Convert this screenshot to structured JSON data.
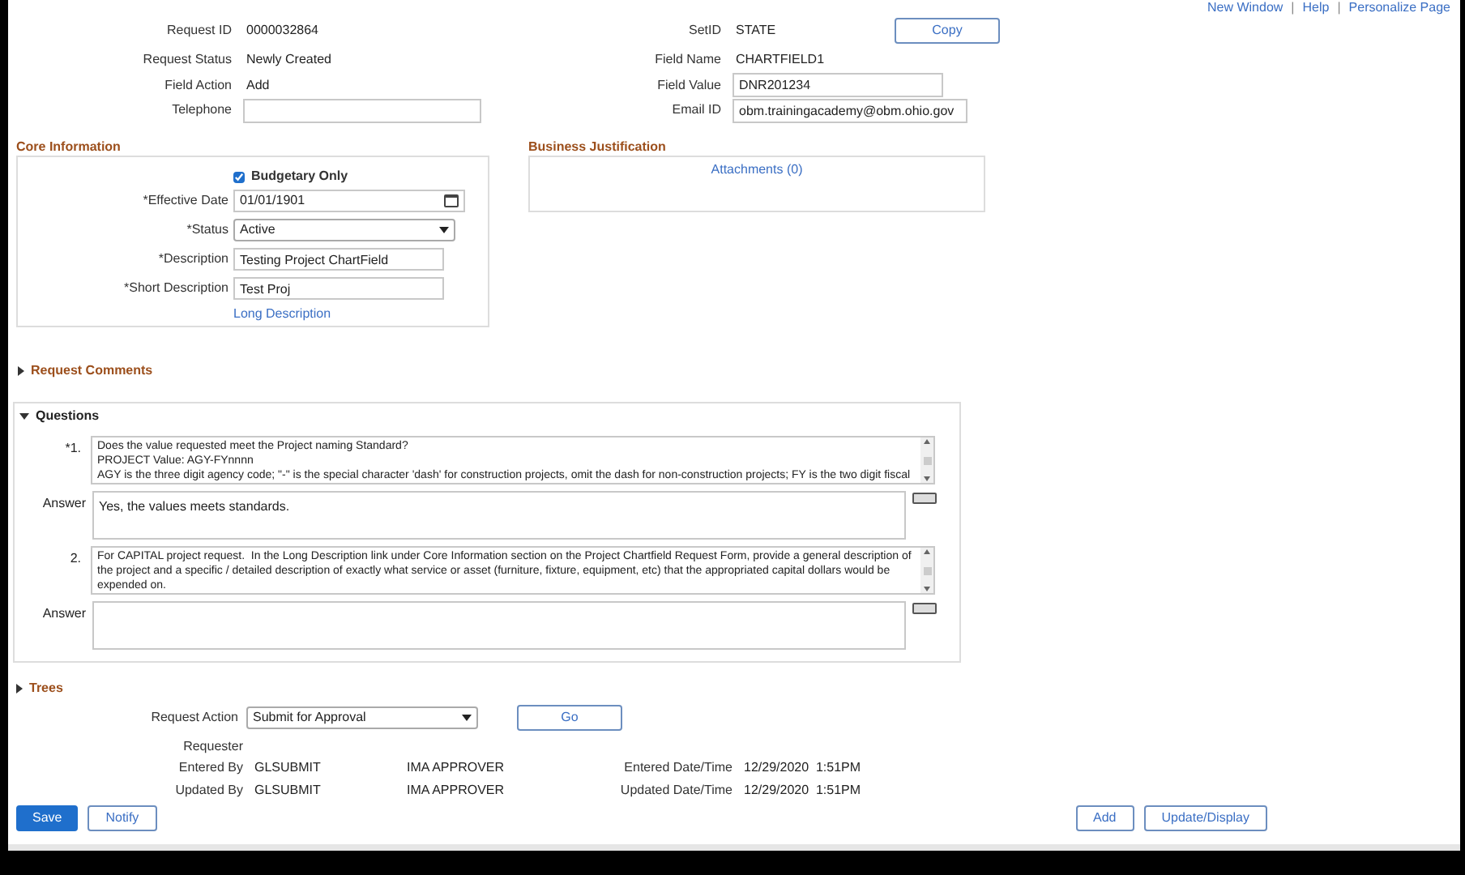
{
  "header_links": [
    "New Window",
    "Help",
    "Personalize Page"
  ],
  "header_link_separator": "|",
  "header_left": [
    {
      "label": "Request ID",
      "value": "0000032864",
      "kind": "text"
    },
    {
      "label": "Request Status",
      "value": "Newly Created",
      "kind": "text"
    },
    {
      "label": "Field Action",
      "value": "Add",
      "kind": "text"
    },
    {
      "label": "Telephone",
      "kind": "input"
    }
  ],
  "header_right": [
    {
      "label": "SetID",
      "value": "STATE",
      "kind": "text"
    },
    {
      "label": "Field Name",
      "value": "CHARTFIELD1",
      "kind": "text"
    },
    {
      "label": "Field Value",
      "value": "DNR201234",
      "kind": "input"
    },
    {
      "label": "Email ID",
      "value": "obm.trainingacademy@obm.ohio.gov",
      "kind": "input"
    }
  ],
  "copy_button": "Copy",
  "core_information": {
    "title": "Core Information",
    "budgetary_only": {
      "label": "Budgetary Only",
      "checked": true
    },
    "fields": [
      {
        "label": "*Effective Date",
        "value": "01/01/1901",
        "kind": "date"
      },
      {
        "label": "*Status",
        "value": "Active",
        "kind": "select"
      },
      {
        "label": "*Description",
        "value": "Testing Project ChartField",
        "kind": "input"
      },
      {
        "label": "*Short Description",
        "value": "Test Proj",
        "kind": "input"
      }
    ],
    "link": "Long Description"
  },
  "business_justification": {
    "title": "Business Justification",
    "link": "Attachments (0)"
  },
  "request_comments": {
    "title": "Request Comments",
    "expanded": false
  },
  "questions": {
    "title": "Questions",
    "expanded": true,
    "items": [
      {
        "number": "*1.",
        "text": "Does the value requested meet the Project naming Standard?\nPROJECT Value: AGY-FYnnnn\nAGY is the three digit agency code; \"-\" is the special character 'dash' for construction projects, omit the dash for non-construction projects; FY is the two digit fiscal",
        "answer_label": "Answer",
        "answer": "Yes, the values meets standards."
      },
      {
        "number": "2.",
        "text": "For CAPITAL project request.  In the Long Description link under Core Information section on the Project Chartfield Request Form, provide a general description of the project and a specific / detailed description of exactly what service or asset (furniture, fixture, equipment, etc) that the appropriated capital dollars would be expended on.",
        "answer_label": "Answer"
      }
    ]
  },
  "trees": {
    "title": "Trees",
    "expanded": false
  },
  "request_action": {
    "label": "Request Action",
    "value": "Submit for Approval",
    "button": "Go"
  },
  "requester_label": "Requester",
  "audit_rows": [
    {
      "label": "Entered By",
      "user": "GLSUBMIT",
      "approver": "IMA APPROVER",
      "date_label": "Entered Date/Time",
      "date": "12/29/2020  1:51PM"
    },
    {
      "label": "Updated By",
      "user": "GLSUBMIT",
      "approver": "IMA APPROVER",
      "date_label": "Updated Date/Time",
      "date": "12/29/2020  1:51PM"
    }
  ],
  "buttons_left": [
    {
      "label": "Save",
      "kind": "primary"
    },
    {
      "label": "Notify",
      "kind": "secondary"
    }
  ],
  "buttons_right": [
    {
      "label": "Add",
      "kind": "secondary"
    },
    {
      "label": "Update/Display",
      "kind": "secondary"
    }
  ]
}
